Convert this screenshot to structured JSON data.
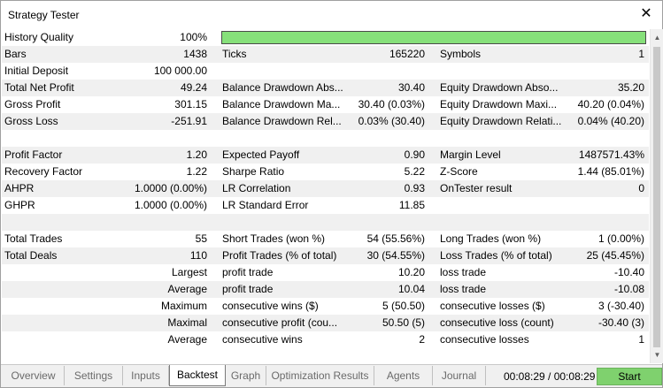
{
  "window": {
    "title": "Strategy Tester"
  },
  "rows": [
    {
      "c1": "History Quality",
      "c2": "100%",
      "c3": "",
      "c4": "",
      "c5": "",
      "c6": ""
    },
    {
      "c1": "Bars",
      "c2": "1438",
      "c3": "Ticks",
      "c4": "165220",
      "c5": "Symbols",
      "c6": "1"
    },
    {
      "c1": "Initial Deposit",
      "c2": "100 000.00",
      "c3": "",
      "c4": "",
      "c5": "",
      "c6": ""
    },
    {
      "c1": "Total Net Profit",
      "c2": "49.24",
      "c3": "Balance Drawdown Abs...",
      "c4": "30.40",
      "c5": "Equity Drawdown Abso...",
      "c6": "35.20"
    },
    {
      "c1": "Gross Profit",
      "c2": "301.15",
      "c3": "Balance Drawdown Ma...",
      "c4": "30.40 (0.03%)",
      "c5": "Equity Drawdown Maxi...",
      "c6": "40.20 (0.04%)"
    },
    {
      "c1": "Gross Loss",
      "c2": "-251.91",
      "c3": "Balance Drawdown Rel...",
      "c4": "0.03% (30.40)",
      "c5": "Equity Drawdown Relati...",
      "c6": "0.04% (40.20)"
    },
    {
      "c1": "",
      "c2": "",
      "c3": "",
      "c4": "",
      "c5": "",
      "c6": ""
    },
    {
      "c1": "Profit Factor",
      "c2": "1.20",
      "c3": "Expected Payoff",
      "c4": "0.90",
      "c5": "Margin Level",
      "c6": "1487571.43%"
    },
    {
      "c1": "Recovery Factor",
      "c2": "1.22",
      "c3": "Sharpe Ratio",
      "c4": "5.22",
      "c5": "Z-Score",
      "c6": "1.44 (85.01%)"
    },
    {
      "c1": "AHPR",
      "c2": "1.0000 (0.00%)",
      "c3": "LR Correlation",
      "c4": "0.93",
      "c5": "OnTester result",
      "c6": "0"
    },
    {
      "c1": "GHPR",
      "c2": "1.0000 (0.00%)",
      "c3": "LR Standard Error",
      "c4": "11.85",
      "c5": "",
      "c6": ""
    },
    {
      "c1": "",
      "c2": "",
      "c3": "",
      "c4": "",
      "c5": "",
      "c6": ""
    },
    {
      "c1": "Total Trades",
      "c2": "55",
      "c3": "Short Trades (won %)",
      "c4": "54 (55.56%)",
      "c5": "Long Trades (won %)",
      "c6": "1 (0.00%)"
    },
    {
      "c1": "Total Deals",
      "c2": "110",
      "c3": "Profit Trades (% of total)",
      "c4": "30 (54.55%)",
      "c5": "Loss Trades (% of total)",
      "c6": "25 (45.45%)"
    },
    {
      "c1": "",
      "c2": "Largest",
      "c3": "profit trade",
      "c4": "10.20",
      "c5": "loss trade",
      "c6": "-10.40"
    },
    {
      "c1": "",
      "c2": "Average",
      "c3": "profit trade",
      "c4": "10.04",
      "c5": "loss trade",
      "c6": "-10.08"
    },
    {
      "c1": "",
      "c2": "Maximum",
      "c3": "consecutive wins ($)",
      "c4": "5 (50.50)",
      "c5": "consecutive losses ($)",
      "c6": "3 (-30.40)"
    },
    {
      "c1": "",
      "c2": "Maximal",
      "c3": "consecutive profit (cou...",
      "c4": "50.50 (5)",
      "c5": "consecutive loss (count)",
      "c6": "-30.40 (3)"
    },
    {
      "c1": "",
      "c2": "Average",
      "c3": "consecutive wins",
      "c4": "2",
      "c5": "consecutive losses",
      "c6": "1"
    }
  ],
  "history_quality_fill": 1.0,
  "tabs": [
    {
      "label": "Overview",
      "name": "tab-overview"
    },
    {
      "label": "Settings",
      "name": "tab-settings"
    },
    {
      "label": "Inputs",
      "name": "tab-inputs"
    },
    {
      "label": "Backtest",
      "name": "tab-backtest"
    },
    {
      "label": "Graph",
      "name": "tab-graph"
    },
    {
      "label": "Optimization Results",
      "name": "tab-optimization-results"
    },
    {
      "label": "Agents",
      "name": "tab-agents"
    },
    {
      "label": "Journal",
      "name": "tab-journal"
    }
  ],
  "active_tab": "Backtest",
  "status": {
    "timer": "00:08:29 / 00:08:29",
    "start_label": "Start"
  },
  "colors": {
    "quality_bar": "#86e07a",
    "start_button": "#7fd16e",
    "row_alt": "#f0f0f0"
  }
}
